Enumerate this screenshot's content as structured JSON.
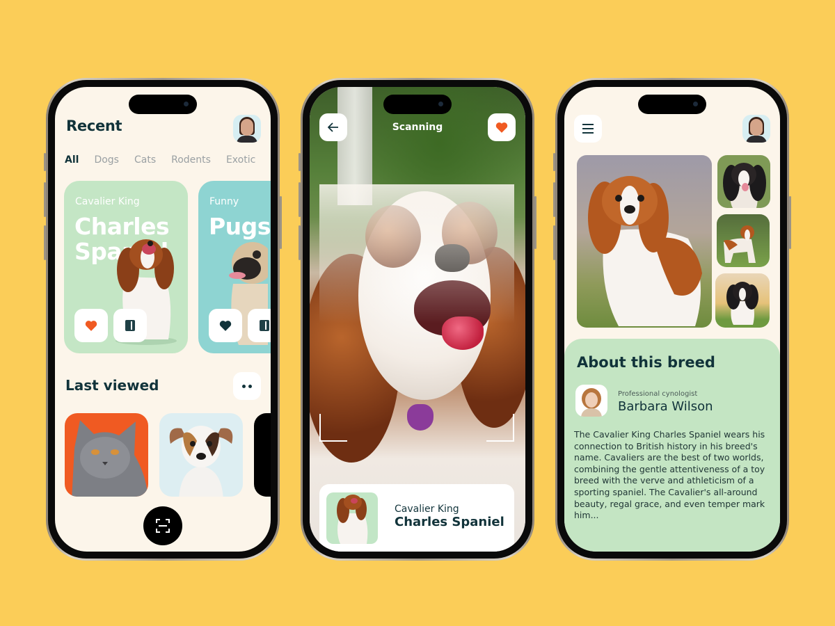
{
  "colors": {
    "background": "#FBCD58",
    "screen_bg": "#FCF5EA",
    "card_green": "#C4E6C5",
    "card_teal": "#8ED4D2",
    "accent_orange": "#F05A22",
    "dark_text": "#11333A",
    "about_bg": "#C4E5C3"
  },
  "phone1": {
    "title": "Recent",
    "avatar_icon": "user-avatar",
    "tabs": [
      {
        "label": "All",
        "active": true
      },
      {
        "label": "Dogs",
        "active": false
      },
      {
        "label": "Cats",
        "active": false
      },
      {
        "label": "Rodents",
        "active": false
      },
      {
        "label": "Exotic",
        "active": false
      }
    ],
    "cards": [
      {
        "subtitle": "Cavalier King",
        "title_line1": "Charles",
        "title_line2": "Spaniel",
        "like_icon": "heart-icon",
        "like_color": "#F05A22",
        "book_icon": "book-icon"
      },
      {
        "subtitle": "Funny",
        "title_line1": "Pugs",
        "title_line2": "",
        "like_icon": "heart-icon",
        "like_color": "#11333A",
        "book_icon": "book-icon"
      }
    ],
    "last_viewed": {
      "title": "Last viewed",
      "more_icon": "more-dots-icon",
      "items": [
        {
          "name": "British Shorthair cat",
          "bg": "#F05A22"
        },
        {
          "name": "Jack Russell terrier",
          "bg": "#DDEEF2"
        },
        {
          "name": "Dark pet",
          "bg": "#000000"
        }
      ]
    },
    "scan_button_icon": "scan-icon"
  },
  "phone2": {
    "title": "Scanning",
    "back_icon": "arrow-left-icon",
    "favorite_icon": "heart-icon",
    "result": {
      "subtitle": "Cavalier King",
      "title": "Charles Spaniel"
    }
  },
  "phone3": {
    "menu_icon": "hamburger-menu-icon",
    "avatar_icon": "user-avatar",
    "gallery": [
      {
        "name": "Blenheim cavalier main photo"
      },
      {
        "name": "Tricolor cavalier"
      },
      {
        "name": "Blenheim cavalier standing"
      },
      {
        "name": "Tricolor puppy"
      }
    ],
    "about": {
      "title": "About this breed",
      "expert_role": "Professional cynologist",
      "expert_name": "Barbara Wilson",
      "text": "The Cavalier King Charles Spaniel wears his connection to British history in his breed's name. Cavaliers are the best of two worlds, combining the gentle attentiveness of a toy breed with the verve and athleticism of a sporting spaniel. The Cavalier's all-around beauty, regal grace, and even temper mark him..."
    }
  }
}
